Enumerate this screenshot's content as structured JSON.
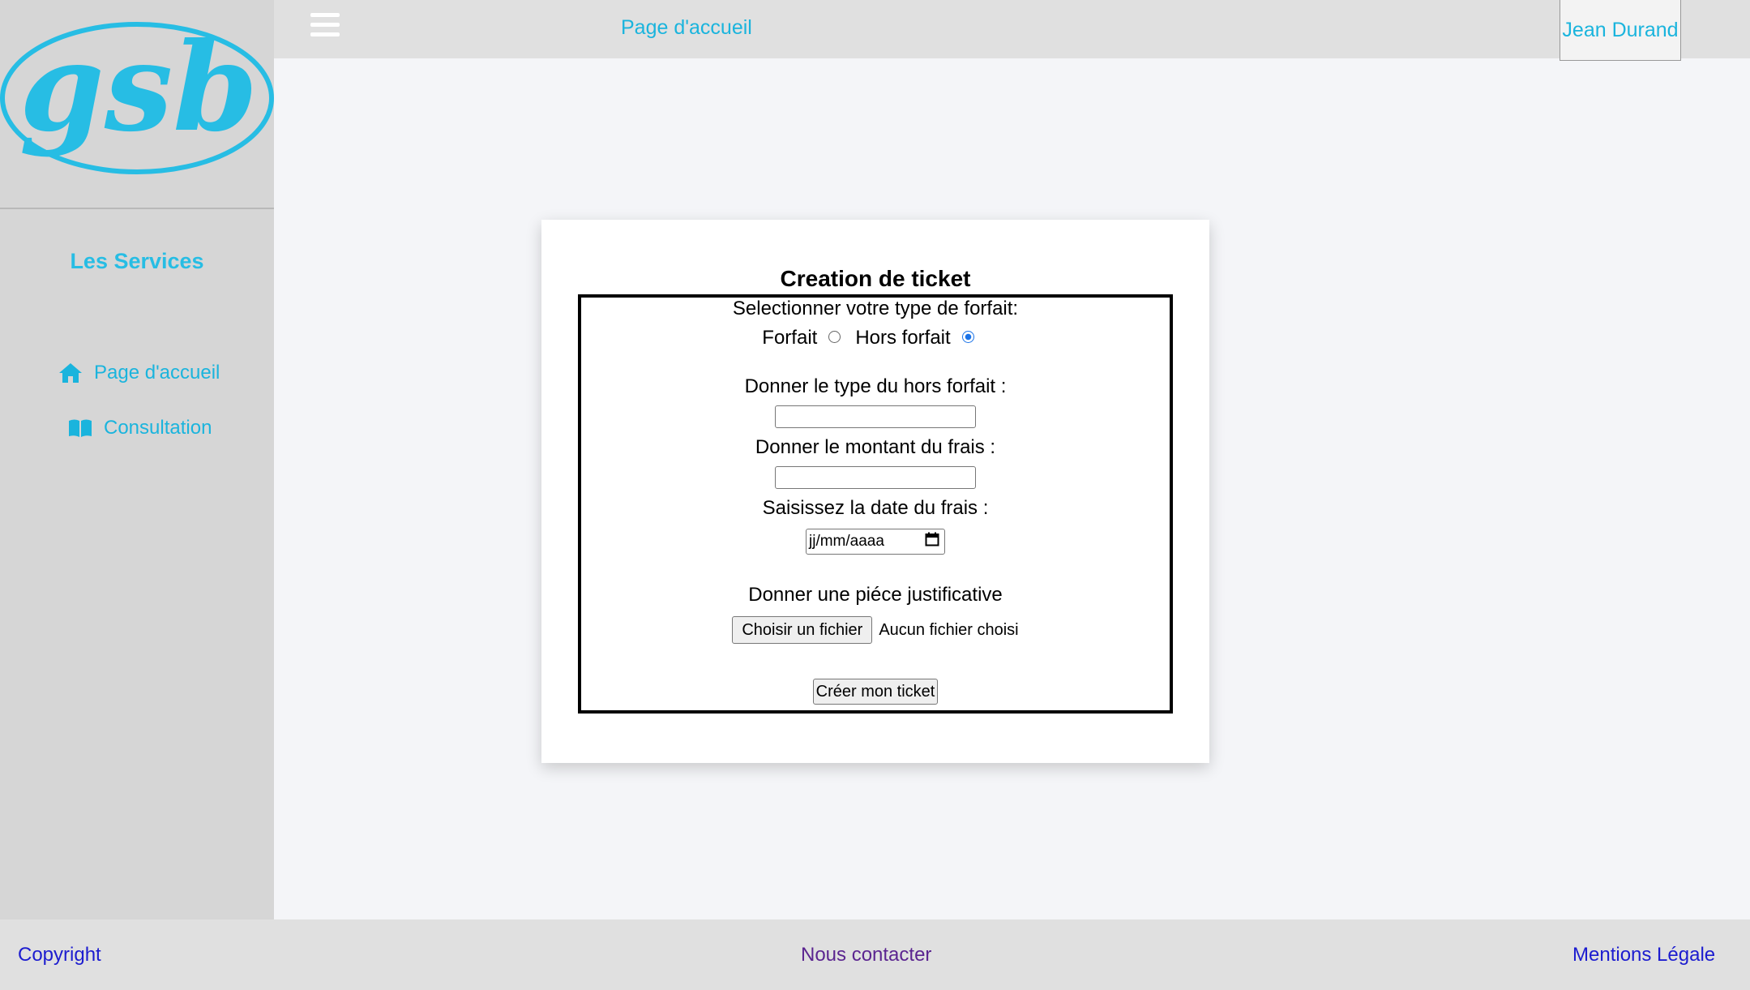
{
  "brand": {
    "logo_text": "gsb",
    "color": "#27bde4"
  },
  "topbar": {
    "menu_icon": "hamburger-icon",
    "home_link": "Page d'accueil",
    "user_name": "Jean Durand"
  },
  "sidebar": {
    "title": "Les Services",
    "items": [
      {
        "label": "Page d'accueil",
        "icon": "home-icon"
      },
      {
        "label": "Consultation",
        "icon": "book-icon"
      }
    ]
  },
  "form": {
    "title": "Creation de ticket",
    "type_prompt": "Selectionner votre type de forfait:",
    "options": [
      {
        "label": "Forfait",
        "checked": false
      },
      {
        "label": "Hors forfait",
        "checked": true
      }
    ],
    "hors_forfait_type_label": "Donner le type du hors forfait :",
    "hors_forfait_type_value": "",
    "montant_label": "Donner le montant du frais :",
    "montant_value": "",
    "date_label": "Saisissez la date du frais :",
    "date_placeholder": "jj/mm/aaaa",
    "piece_label": "Donner une piéce justificative",
    "file_button": "Choisir un fichier",
    "file_status": "Aucun fichier choisi",
    "submit": "Créer mon ticket"
  },
  "footer": {
    "copyright": "Copyright",
    "contact": "Nous contacter",
    "legal": "Mentions Légale"
  }
}
